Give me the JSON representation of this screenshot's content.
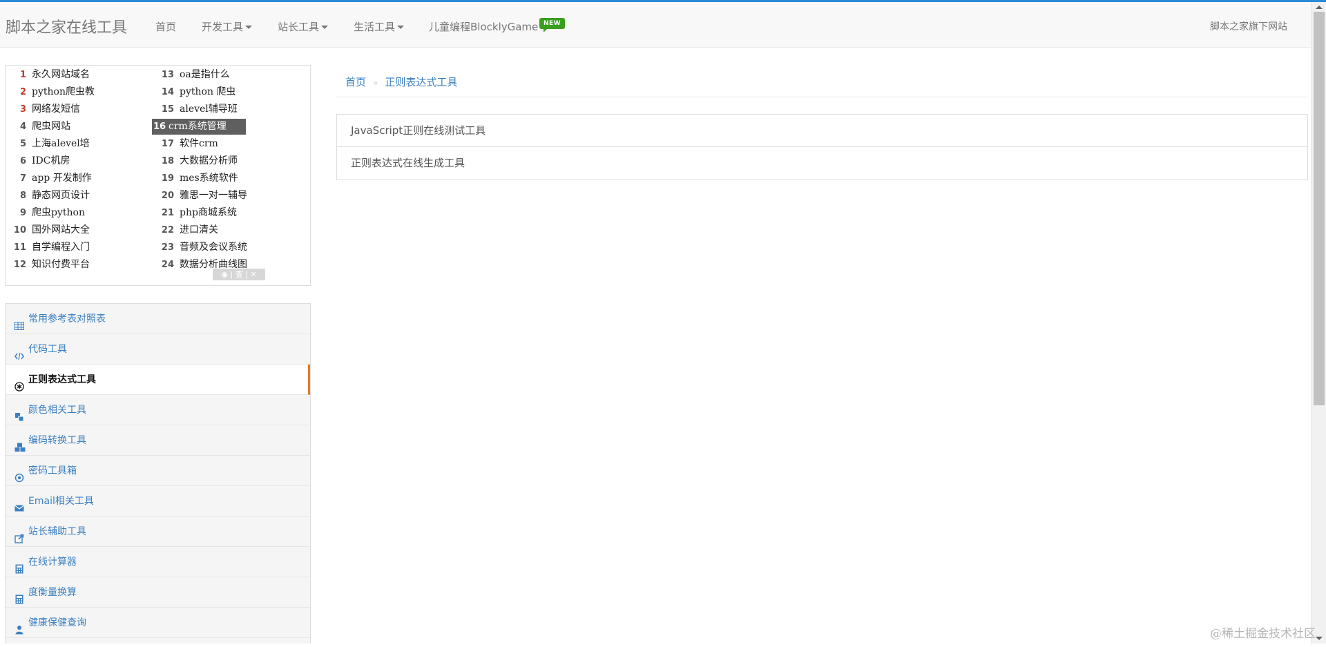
{
  "nav": {
    "brand": "脚本之家在线工具",
    "items": [
      {
        "label": "首页",
        "dropdown": false
      },
      {
        "label": "开发工具",
        "dropdown": true
      },
      {
        "label": "站长工具",
        "dropdown": true
      },
      {
        "label": "生活工具",
        "dropdown": true
      },
      {
        "label": "儿童编程BlocklyGame",
        "dropdown": false
      }
    ],
    "new_badge": "NEW",
    "right_link": "脚本之家旗下网站"
  },
  "ad_links": {
    "left": [
      {
        "num": "1",
        "text": "永久网站域名"
      },
      {
        "num": "2",
        "text": "python爬虫教"
      },
      {
        "num": "3",
        "text": "网络发短信"
      },
      {
        "num": "4",
        "text": "爬虫网站"
      },
      {
        "num": "5",
        "text": "上海alevel培"
      },
      {
        "num": "6",
        "text": "IDC机房"
      },
      {
        "num": "7",
        "text": "app 开发制作"
      },
      {
        "num": "8",
        "text": "静态网页设计"
      },
      {
        "num": "9",
        "text": "爬虫python"
      },
      {
        "num": "10",
        "text": "国外网站大全"
      },
      {
        "num": "11",
        "text": "自学编程入门"
      },
      {
        "num": "12",
        "text": "知识付费平台"
      }
    ],
    "right": [
      {
        "num": "13",
        "text": "oa是指什么"
      },
      {
        "num": "14",
        "text": "python 爬虫"
      },
      {
        "num": "15",
        "text": "alevel辅导班"
      },
      {
        "num": "16",
        "text": "crm系统管理"
      },
      {
        "num": "17",
        "text": "软件crm"
      },
      {
        "num": "18",
        "text": "大数据分析师"
      },
      {
        "num": "19",
        "text": "mes系统软件"
      },
      {
        "num": "20",
        "text": "雅思一对一辅导"
      },
      {
        "num": "21",
        "text": "php商城系统"
      },
      {
        "num": "22",
        "text": "进口清关"
      },
      {
        "num": "23",
        "text": "音频及会议系统"
      },
      {
        "num": "24",
        "text": "数据分析曲线图"
      }
    ],
    "highlighted_index": 16,
    "ad_controls": "◉ | 查 | ✕"
  },
  "sidebar": {
    "items": [
      {
        "label": "常用参考表对照表",
        "icon": "table-icon"
      },
      {
        "label": "代码工具",
        "icon": "code-icon"
      },
      {
        "label": "正则表达式工具",
        "icon": "asterisk-icon",
        "active": true
      },
      {
        "label": "颜色相关工具",
        "icon": "color-palette-icon"
      },
      {
        "label": "编码转换工具",
        "icon": "cubes-icon"
      },
      {
        "label": "密码工具箱",
        "icon": "target-icon"
      },
      {
        "label": "Email相关工具",
        "icon": "envelope-icon"
      },
      {
        "label": "站长辅助工具",
        "icon": "share-icon"
      },
      {
        "label": "在线计算器",
        "icon": "calculator-icon"
      },
      {
        "label": "度衡量换算",
        "icon": "calculator-icon"
      },
      {
        "label": "健康保健查询",
        "icon": "user-icon"
      }
    ]
  },
  "breadcrumb": {
    "home": "首页",
    "separator": "»",
    "current": "正则表达式工具"
  },
  "tools": [
    {
      "label": "JavaScript正则在线测试工具"
    },
    {
      "label": "正则表达式在线生成工具"
    }
  ],
  "watermark": "@稀土掘金技术社区",
  "colors": {
    "link": "#3a7fc1",
    "active_border": "#e07b1c",
    "new_badge": "#3a9e1f",
    "top_line": "#2b8ad8",
    "ad_highlight": "#5f5f5f"
  }
}
